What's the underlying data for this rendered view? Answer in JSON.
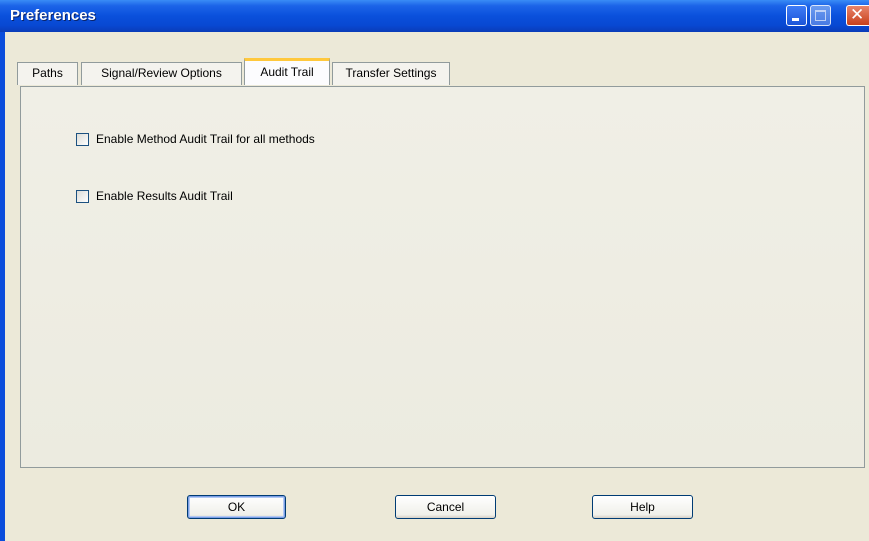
{
  "window": {
    "title": "Preferences"
  },
  "title_buttons": {
    "minimize": "minimize",
    "maximize": "maximize",
    "close": "close"
  },
  "tabs": [
    {
      "label": "Paths",
      "active": false
    },
    {
      "label": "Signal/Review Options",
      "active": false
    },
    {
      "label": "Audit Trail",
      "active": true
    },
    {
      "label": "Transfer Settings",
      "active": false
    }
  ],
  "options": {
    "method_audit_trail": {
      "label": "Enable Method Audit Trail for all methods",
      "checked": false
    },
    "results_audit_trail": {
      "label": "Enable Results Audit Trail",
      "checked": false
    }
  },
  "buttons": {
    "ok": "OK",
    "cancel": "Cancel",
    "help": "Help"
  },
  "colors": {
    "titlebar": "#0a50dc",
    "client": "#ece9d8",
    "active_tab_accent": "#ffc83c",
    "close_button": "#c8401c"
  }
}
